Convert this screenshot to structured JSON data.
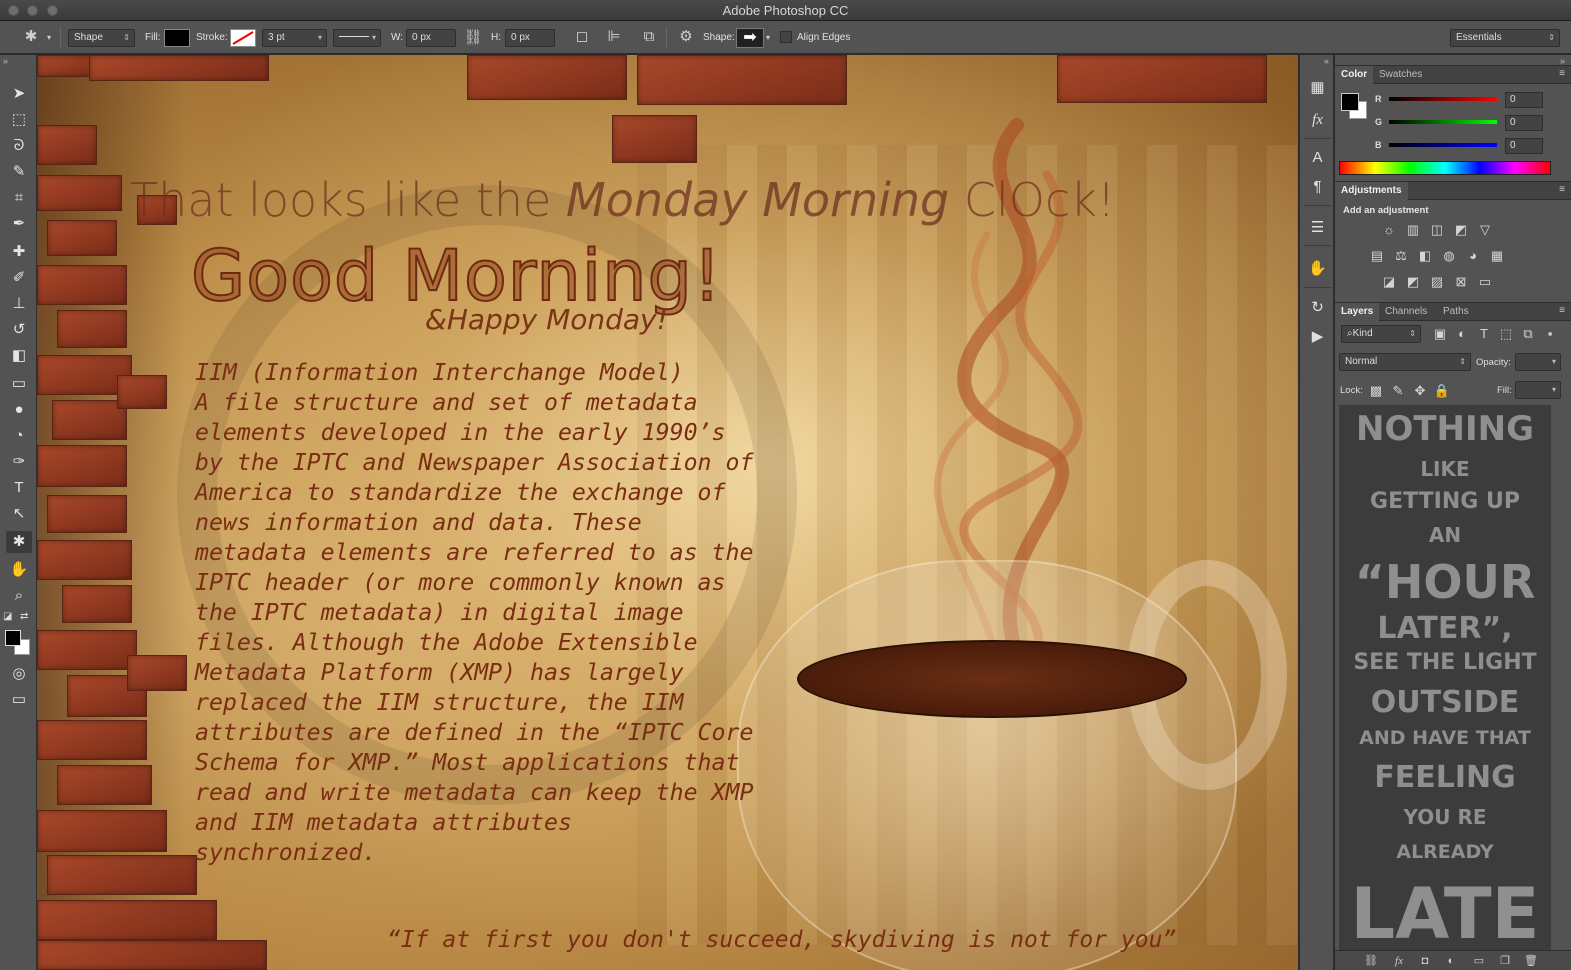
{
  "window": {
    "title": "Adobe Photoshop CC"
  },
  "options_bar": {
    "mode_select": "Shape",
    "fill_label": "Fill:",
    "stroke_label": "Stroke:",
    "stroke_width": "3 pt",
    "w_label": "W:",
    "w_value": "0 px",
    "h_label": "H:",
    "h_value": "0 px",
    "shape_label": "Shape:",
    "align_edges_label": "Align Edges",
    "workspace": "Essentials",
    "shape_icon": "arrow-right-icon"
  },
  "tools": [
    {
      "name": "move-tool",
      "icon": "➤"
    },
    {
      "name": "marquee-tool",
      "icon": "⬚"
    },
    {
      "name": "lasso-tool",
      "icon": "ᘐ"
    },
    {
      "name": "quick-select-tool",
      "icon": "✎"
    },
    {
      "name": "crop-tool",
      "icon": "⌗"
    },
    {
      "name": "eyedropper-tool",
      "icon": "✒"
    },
    {
      "name": "healing-brush-tool",
      "icon": "✚"
    },
    {
      "name": "brush-tool",
      "icon": "✐"
    },
    {
      "name": "clone-stamp-tool",
      "icon": "⊥"
    },
    {
      "name": "history-brush-tool",
      "icon": "↺"
    },
    {
      "name": "eraser-tool",
      "icon": "◧"
    },
    {
      "name": "gradient-tool",
      "icon": "▭"
    },
    {
      "name": "blur-tool",
      "icon": "●"
    },
    {
      "name": "dodge-tool",
      "icon": "◔"
    },
    {
      "name": "pen-tool",
      "icon": "✑"
    },
    {
      "name": "type-tool",
      "icon": "T"
    },
    {
      "name": "path-select-tool",
      "icon": "↖"
    },
    {
      "name": "custom-shape-tool",
      "icon": "✱"
    },
    {
      "name": "hand-tool",
      "icon": "✋"
    },
    {
      "name": "zoom-tool",
      "icon": "⌕"
    }
  ],
  "canvas": {
    "headline_plain": "That looks like the ",
    "headline_italic": "Monday Morning",
    "headline_end": " ClOck!",
    "greeting": "Good Morning!",
    "subgreeting": "&Happy Monday!",
    "body": "IIM (Information Interchange Model)\nA file structure and set of metadata\nelements developed in the early 1990’s\nby the IPTC and Newspaper Association of\nAmerica to standardize the exchange of\nnews information and data. These\nmetadata elements are referred to as the\nIPTC header (or more commonly known as\nthe IPTC metadata) in digital image\nfiles. Although the Adobe Extensible\nMetadata Platform (XMP) has largely\nreplaced the IIM structure, the IIM\nattributes are defined in the “IPTC Core\nSchema for XMP.” Most applications that\nread and write metadata can keep the XMP\nand IIM metadata attributes\nsynchronized.",
    "quote": "“If at first you don't succeed, skydiving is not for you”"
  },
  "color_panel": {
    "tabs": [
      "Color",
      "Swatches"
    ],
    "r_label": "R",
    "g_label": "G",
    "b_label": "B",
    "r_value": "0",
    "g_value": "0",
    "b_value": "0"
  },
  "adjustments_panel": {
    "title": "Adjustments",
    "subtitle": "Add an adjustment"
  },
  "layers_panel": {
    "tabs": [
      "Layers",
      "Channels",
      "Paths"
    ],
    "filter": "Kind",
    "blend_mode": "Normal",
    "opacity_label": "Opacity:",
    "lock_label": "Lock:",
    "fill_label": "Fill:",
    "thumb_lines": [
      "NOTHING",
      "LIKE",
      "GETTING UP",
      "AN",
      "“HOUR",
      "LATER”,",
      "SEE THE LIGHT",
      "OUTSIDE",
      "AND HAVE THAT",
      "FEELING",
      "YOU RE",
      "ALREADY",
      "LATE"
    ]
  }
}
